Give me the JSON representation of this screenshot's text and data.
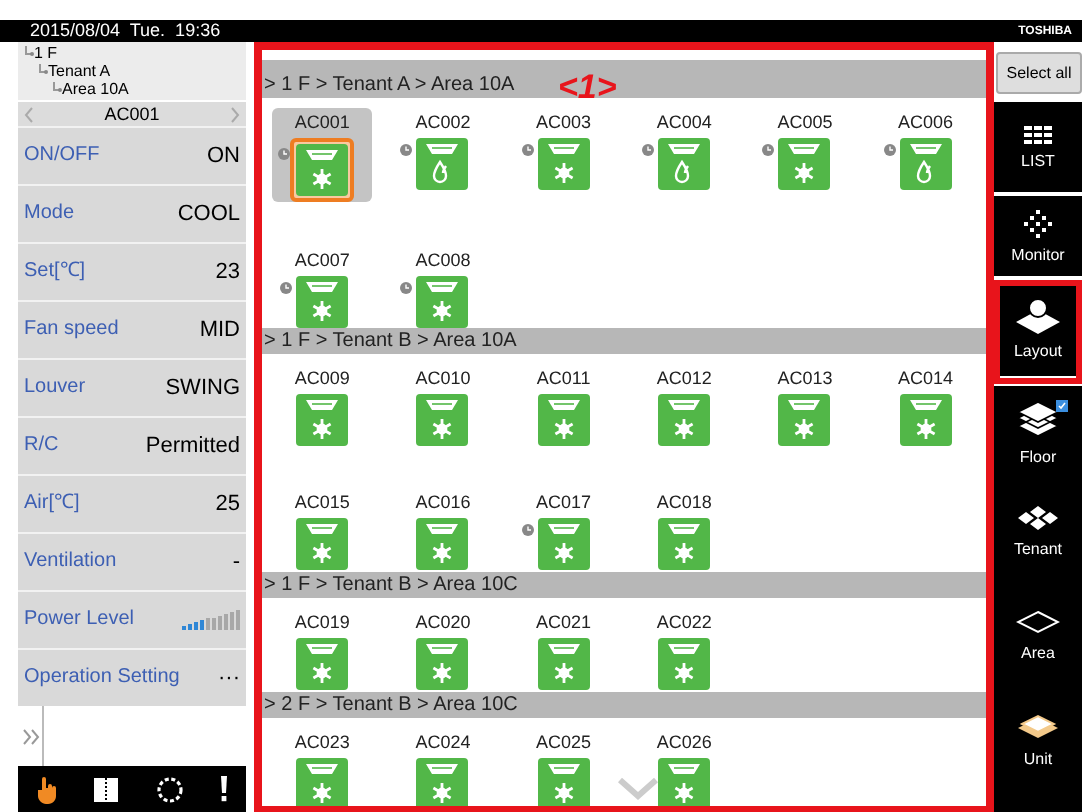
{
  "status_bar": {
    "datetime": "2015/08/04  Tue.  19:36",
    "brand": "TOSHIBA"
  },
  "tree": [
    {
      "label": "1 F",
      "children": [
        {
          "label": "Tenant A",
          "children": [
            {
              "label": "Area 10A"
            }
          ]
        }
      ]
    }
  ],
  "unit_nav": {
    "unit": "AC001"
  },
  "properties": [
    {
      "label": "ON/OFF",
      "kind": "text",
      "value": "ON"
    },
    {
      "label": "Mode",
      "kind": "text",
      "value": "COOL"
    },
    {
      "label": "Set[℃]",
      "kind": "text",
      "value": "23"
    },
    {
      "label": "Fan speed",
      "kind": "text",
      "value": "MID"
    },
    {
      "label": "Louver",
      "kind": "text",
      "value": "SWING"
    },
    {
      "label": "R/C",
      "kind": "text",
      "value": "Permitted"
    },
    {
      "label": "Air[℃]",
      "kind": "text",
      "value": "25"
    },
    {
      "label": "Ventilation",
      "kind": "text",
      "value": "-"
    },
    {
      "label": "Power Level",
      "kind": "meter",
      "level": 0.4
    },
    {
      "label": "Operation Setting",
      "kind": "text",
      "value": "···"
    }
  ],
  "bottom_toolbar": [
    {
      "kind": "hand",
      "selected": true
    },
    {
      "kind": "book",
      "selected": false
    },
    {
      "kind": "ring",
      "selected": false
    },
    {
      "kind": "alert",
      "selected": false
    }
  ],
  "sections": [
    {
      "path": "> 1 F > Tenant A > Area 10A",
      "units": [
        {
          "name": "AC001",
          "kind": "cool",
          "timer": true,
          "selected": true
        },
        {
          "name": "AC002",
          "kind": "dry",
          "timer": true,
          "selected": false
        },
        {
          "name": "AC003",
          "kind": "cool",
          "timer": true,
          "selected": false
        },
        {
          "name": "AC004",
          "kind": "dry",
          "timer": true,
          "selected": false
        },
        {
          "name": "AC005",
          "kind": "cool",
          "timer": true,
          "selected": false
        },
        {
          "name": "AC006",
          "kind": "dry",
          "timer": true,
          "selected": false
        },
        {
          "name": "AC007",
          "kind": "cool",
          "timer": true,
          "selected": false
        },
        {
          "name": "AC008",
          "kind": "cool",
          "timer": true,
          "selected": false
        }
      ]
    },
    {
      "path": "> 1 F > Tenant B > Area 10A",
      "units": [
        {
          "name": "AC009",
          "kind": "cool",
          "timer": false,
          "selected": false
        },
        {
          "name": "AC010",
          "kind": "cool",
          "timer": false,
          "selected": false
        },
        {
          "name": "AC011",
          "kind": "cool",
          "timer": false,
          "selected": false
        },
        {
          "name": "AC012",
          "kind": "cool",
          "timer": false,
          "selected": false
        },
        {
          "name": "AC013",
          "kind": "cool",
          "timer": false,
          "selected": false
        },
        {
          "name": "AC014",
          "kind": "cool",
          "timer": false,
          "selected": false
        },
        {
          "name": "AC015",
          "kind": "cool",
          "timer": false,
          "selected": false
        },
        {
          "name": "AC016",
          "kind": "cool",
          "timer": false,
          "selected": false
        },
        {
          "name": "AC017",
          "kind": "cool",
          "timer": true,
          "selected": false
        },
        {
          "name": "AC018",
          "kind": "cool",
          "timer": false,
          "selected": false
        }
      ]
    },
    {
      "path": "> 1 F > Tenant B > Area 10C",
      "units": [
        {
          "name": "AC019",
          "kind": "cool",
          "timer": false,
          "selected": false
        },
        {
          "name": "AC020",
          "kind": "cool",
          "timer": false,
          "selected": false
        },
        {
          "name": "AC021",
          "kind": "cool",
          "timer": false,
          "selected": false
        },
        {
          "name": "AC022",
          "kind": "cool",
          "timer": false,
          "selected": false
        }
      ]
    },
    {
      "path": "> 2 F > Tenant B > Area 10C",
      "units": [
        {
          "name": "AC023",
          "kind": "cool",
          "timer": false,
          "selected": false
        },
        {
          "name": "AC024",
          "kind": "cool",
          "timer": false,
          "selected": false
        },
        {
          "name": "AC025",
          "kind": "cool",
          "timer": false,
          "selected": false
        },
        {
          "name": "AC026",
          "kind": "cool",
          "timer": false,
          "selected": false
        }
      ]
    }
  ],
  "annotation": {
    "callout": "<1>"
  },
  "sidebar": {
    "select_all": "Select all",
    "views": [
      {
        "label": "LIST",
        "kind": "list"
      },
      {
        "label": "Monitor",
        "kind": "monitor"
      },
      {
        "label": "Layout",
        "kind": "layout"
      }
    ],
    "levels": [
      {
        "label": "Floor",
        "kind": "floor",
        "badge": true,
        "selected": false
      },
      {
        "label": "Tenant",
        "kind": "tenant",
        "badge": false,
        "selected": false
      },
      {
        "label": "Area",
        "kind": "area",
        "badge": false,
        "selected": false
      },
      {
        "label": "Unit",
        "kind": "unit",
        "badge": false,
        "selected": true
      }
    ]
  }
}
